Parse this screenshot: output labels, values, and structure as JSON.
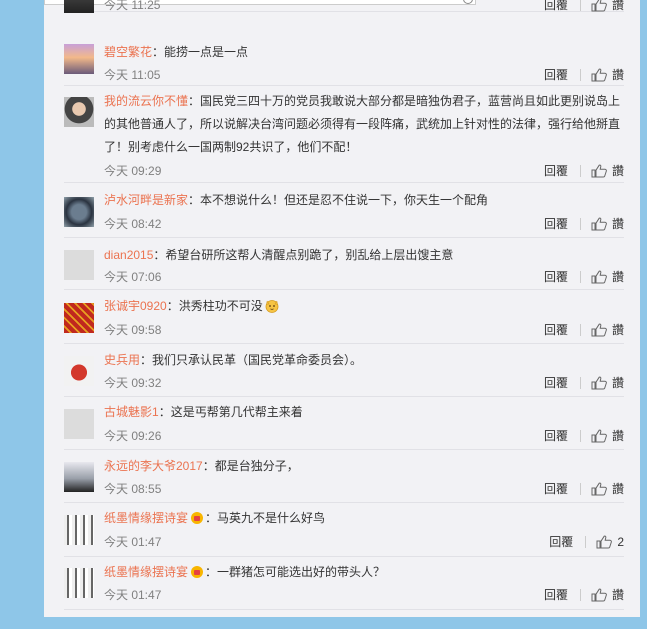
{
  "comments": [
    {
      "user": "",
      "text": "",
      "time": "今天 11:25",
      "reply": "回覆",
      "like": "讚",
      "emoji": false,
      "vip": false
    },
    {
      "user": "碧空繁花",
      "text": "能捞一点是一点",
      "time": "今天 11:05",
      "reply": "回覆",
      "like": "讚",
      "emoji": false,
      "vip": false
    },
    {
      "user": "我的流云你不懂",
      "text": "国民党三四十万的党员我敢说大部分都是暗独伪君子，蓝营尚且如此更别说岛上的其他普通人了，所以说解决台湾问题必须得有一段阵痛，武统加上针对性的法律，强行给他掰直了！别考虑什么一国两制92共识了，他们不配！",
      "time": "今天 09:29",
      "reply": "回覆",
      "like": "讚",
      "emoji": false,
      "vip": false
    },
    {
      "user": "泸水河畔是新家",
      "text": "本不想说什么！但还是忍不住说一下，你天生一个配角",
      "time": "今天 08:42",
      "reply": "回覆",
      "like": "讚",
      "emoji": false,
      "vip": false
    },
    {
      "user": "dian2015",
      "text": "希望台研所这帮人清醒点别跪了，别乱给上层出馊主意",
      "time": "今天 07:06",
      "reply": "回覆",
      "like": "讚",
      "emoji": false,
      "vip": false
    },
    {
      "user": "张诚宇0920",
      "text": "洪秀柱功不可没",
      "time": "今天 09:58",
      "reply": "回覆",
      "like": "讚",
      "emoji": true,
      "vip": false
    },
    {
      "user": "史兵用",
      "text": "我们只承认民革（国民党革命委员会）。",
      "time": "今天 09:32",
      "reply": "回覆",
      "like": "讚",
      "emoji": false,
      "vip": false
    },
    {
      "user": "古城魅影1",
      "text": "这是丐帮第几代帮主来着",
      "time": "今天 09:26",
      "reply": "回覆",
      "like": "讚",
      "emoji": false,
      "vip": false
    },
    {
      "user": "永远的李大爷2017",
      "text": "都是台独分子，",
      "time": "今天 08:55",
      "reply": "回覆",
      "like": "讚",
      "emoji": false,
      "vip": false
    },
    {
      "user": "纸墨情缘摆诗宴",
      "text": "马英九不是什么好鸟",
      "time": "今天 01:47",
      "reply": "回覆",
      "like": "2",
      "emoji": false,
      "vip": true
    },
    {
      "user": "纸墨情缘摆诗宴",
      "text": "一群猪怎可能选出好的带头人？",
      "time": "今天 01:47",
      "reply": "回覆",
      "like": "讚",
      "emoji": false,
      "vip": true
    }
  ],
  "colors": {
    "username": "#eb7350",
    "meta": "#808080",
    "panel": "#f2f2f5",
    "background": "#8ec6e8"
  },
  "icons": {
    "like": "thumbs-up-icon",
    "emoji": "cat-emoji-icon",
    "vip": "vip-badge-icon"
  }
}
